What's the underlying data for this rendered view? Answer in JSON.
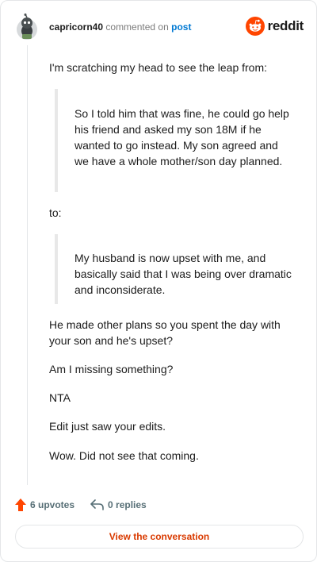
{
  "header": {
    "username": "capricorn40",
    "commented_on": "commented on",
    "post_link": "post",
    "brand": "reddit"
  },
  "comment": {
    "intro": "I'm scratching my head to see the leap from:",
    "quote1": "So I told him that was fine, he could go help his friend and asked my son 18M if he wanted to go instead. My son agreed and we have a whole mother/son day planned.",
    "to": "to:",
    "quote2": "My husband is now upset with me, and basically said that I was being over dramatic and inconsiderate.",
    "p1": "He made other plans so you spent the day with your son and he's upset?",
    "p2": "Am I missing something?",
    "p3": "NTA",
    "p4": "Edit just saw your edits.",
    "p5": "Wow. Did not see that coming."
  },
  "footer": {
    "upvotes": "6 upvotes",
    "replies": "0 replies",
    "cta": "View the conversation"
  },
  "colors": {
    "brand_orange": "#ff4500",
    "link_blue": "#0079d3",
    "cta_text": "#d93a00"
  },
  "icons": [
    "avatar-icon",
    "reddit-logo-icon",
    "upvote-arrow-icon",
    "reply-arrow-icon"
  ]
}
